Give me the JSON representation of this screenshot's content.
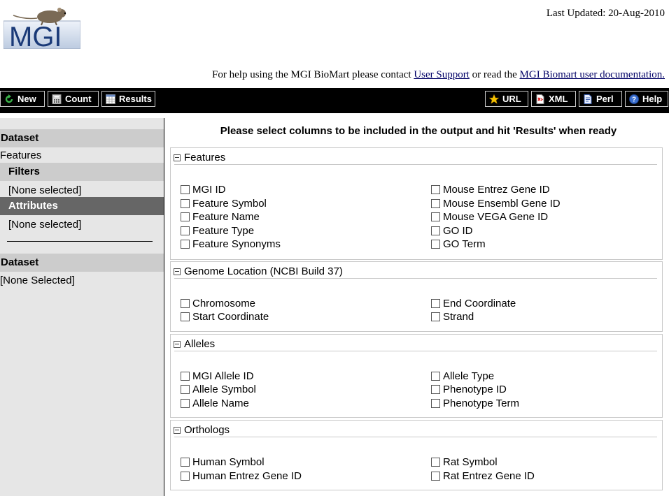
{
  "header": {
    "logo_text": "MGI",
    "last_updated": "Last Updated: 20-Aug-2010",
    "help_prefix": "For help using the MGI BioMart please contact ",
    "help_link_support": "User Support",
    "help_middle": " or read the ",
    "help_link_docs": "MGI Biomart user documentation."
  },
  "toolbar": {
    "new": "New",
    "count": "Count",
    "results": "Results",
    "url": "URL",
    "xml": "XML",
    "perl": "Perl",
    "help": "Help"
  },
  "sidebar": {
    "dataset1_heading": "Dataset",
    "dataset1_value": "Features",
    "filters_heading": "Filters",
    "filters_value": "[None selected]",
    "attributes_heading": "Attributes",
    "attributes_value": "[None selected]",
    "dataset2_heading": "Dataset",
    "dataset2_value": "[None Selected]"
  },
  "main": {
    "title": "Please select columns to be included in the output and hit 'Results' when ready",
    "groups": [
      {
        "title": "Features",
        "left": [
          "MGI ID",
          "Feature Symbol",
          "Feature Name",
          "Feature Type",
          "Feature Synonyms"
        ],
        "right": [
          "Mouse Entrez Gene ID",
          "Mouse Ensembl Gene ID",
          "Mouse VEGA Gene ID",
          "GO ID",
          "GO Term"
        ]
      },
      {
        "title": "Genome Location (NCBI Build 37)",
        "left": [
          "Chromosome",
          "Start Coordinate"
        ],
        "right": [
          "End Coordinate",
          "Strand"
        ]
      },
      {
        "title": "Alleles",
        "left": [
          "MGI Allele ID",
          "Allele Symbol",
          "Allele Name"
        ],
        "right": [
          "Allele Type",
          "Phenotype ID",
          "Phenotype Term"
        ]
      },
      {
        "title": "Orthologs",
        "left": [
          "Human Symbol",
          "Human Entrez Gene ID"
        ],
        "right": [
          "Rat Symbol",
          "Rat Entrez Gene ID"
        ]
      }
    ]
  },
  "colors": {
    "toolbar_bg": "#000000",
    "sidebar_bg": "#e6e6e6",
    "sidebar_heading_bg": "#cccccc",
    "attributes_heading_bg": "#666666",
    "link": "#000066",
    "logo_blue": "#1a3a78"
  },
  "icons": {
    "new": "green-refresh-icon",
    "count": "calculator-icon",
    "results": "table-icon",
    "url": "star-icon",
    "xml": "xml-document-icon",
    "perl": "script-document-icon",
    "help": "help-circle-icon"
  }
}
